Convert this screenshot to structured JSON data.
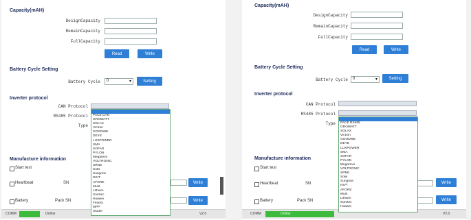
{
  "left": {
    "capacity_title": "Capacity(mAH)",
    "design_capacity_label": "DesignCapacity",
    "remain_capacity_label": "RemainCapacity",
    "full_capacity_label": "FullCapacity",
    "read_button": "Read",
    "write_button": "Write",
    "battery_cycle_title": "Battery Cycle Setting",
    "battery_cycle_label": "Battery Cycle",
    "battery_cycle_value": "0",
    "battery_cycle_button": "Setting",
    "inverter_title": "Inverter protocol",
    "can_label": "CAN Protocol",
    "rs485_label": "RS485 Protocol",
    "type_label": "Type",
    "protocol_items": [
      "PACE CAN",
      "GROWATT",
      "SOLAX",
      "Victron",
      "GOODWE",
      "DEYE",
      "LUXPOWER",
      "SMA",
      "SOFAR",
      "PYLON",
      "Megarevo",
      "VOLTRONIC",
      "SRNE",
      "Solis",
      "Sungrow",
      "INVT",
      "AFORE",
      "Must",
      "Lithium",
      "Sorotec",
      "Huawei",
      "Felicity",
      "MPP",
      "Studer"
    ],
    "manufacture_title": "Manufacture information",
    "start_text": "Start test",
    "heartbeat_text": "Heartbeat",
    "sn_label": "SN",
    "battery_text": "Battery",
    "pack_label": "Pack SN",
    "status_label": "COMM",
    "status_text": "Online",
    "version": "V2.0"
  },
  "right": {
    "capacity_title": "Capacity(mAH)",
    "design_capacity_label": "DesignCapacity",
    "remain_capacity_label": "RemainCapacity",
    "full_capacity_label": "FullCapacity",
    "read_button": "Read",
    "write_button": "Write",
    "battery_cycle_title": "Battery Cycle Setting",
    "battery_cycle_label": "Battery Cycle",
    "battery_cycle_value": "0",
    "battery_cycle_button": "Setting",
    "inverter_title": "Inverter protocol",
    "can_label": "CAN Protocol",
    "rs485_label": "RS485 Protocol",
    "type_label": "Type",
    "protocol_items": [
      "PACE RS485",
      "GROWATT",
      "SOLAX",
      "Victron",
      "GOODWE",
      "DEYE",
      "LUXPOWER",
      "SMA",
      "SOFAR",
      "PYLON",
      "Megarevo",
      "VOLTRONIC",
      "SRNE",
      "Solis",
      "Sungrow",
      "INVT",
      "AFORE",
      "Must",
      "Lithium",
      "Sorotec",
      "Huawei"
    ],
    "manufacture_title": "Manufacture information",
    "start_text": "Start test",
    "heartbeat_text": "Heartbeat",
    "sn_label": "SN",
    "battery_text": "Battery",
    "pack_label": "Pack SN",
    "status_label": "COMM",
    "status_text": "Online",
    "version": "V2.0"
  }
}
